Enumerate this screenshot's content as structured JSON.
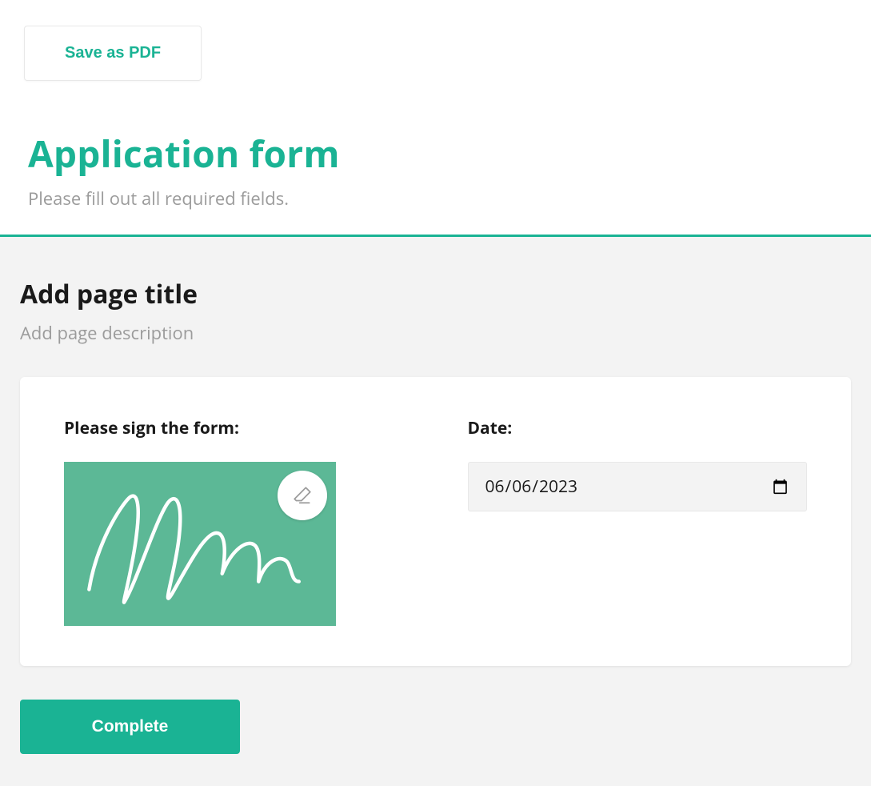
{
  "header": {
    "save_pdf_label": "Save as PDF",
    "form_title": "Application form",
    "form_subtitle": "Please fill out all required fields."
  },
  "page": {
    "title": "Add page title",
    "description": "Add page description"
  },
  "sign": {
    "label": "Please sign the form:"
  },
  "date": {
    "label": "Date:",
    "value": "2023-06-06",
    "display": "06/06/2023"
  },
  "footer": {
    "complete_label": "Complete"
  },
  "colors": {
    "accent": "#1ab394",
    "signature_bg": "#5cb896"
  }
}
